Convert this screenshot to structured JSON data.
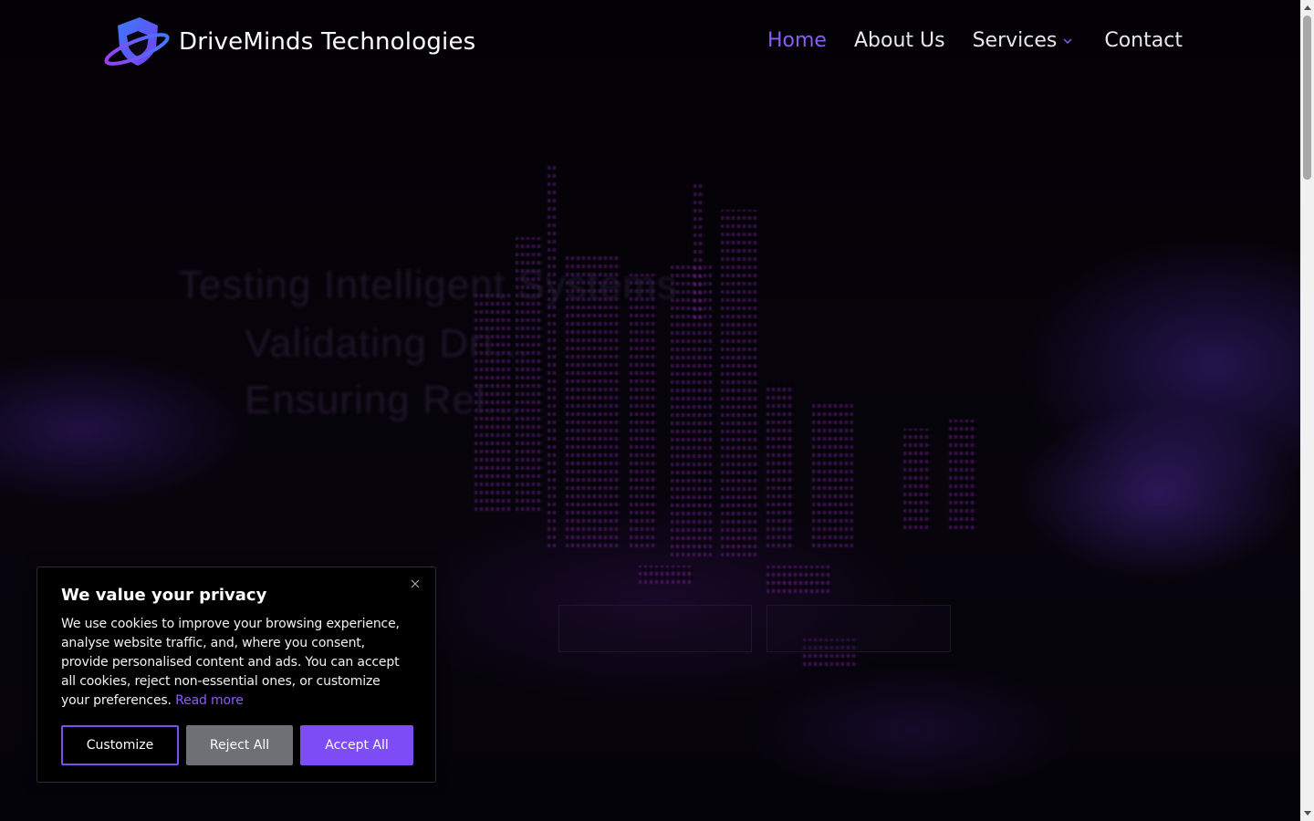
{
  "brand": {
    "name": "DriveMinds Technologies",
    "accent_color": "#8a5cf6"
  },
  "nav": {
    "items": [
      {
        "label": "Home",
        "active": true
      },
      {
        "label": "About Us",
        "active": false
      },
      {
        "label": "Services",
        "active": false,
        "has_dropdown": true
      },
      {
        "label": "Contact",
        "active": false
      }
    ]
  },
  "hero": {
    "lines": [
      "Testing Intelligent Systems",
      "Validating Dri...",
      "Ensuring Rel..."
    ]
  },
  "cookie": {
    "title": "We value your privacy",
    "body": "We use cookies to improve your browsing experience, analyse website traffic, and, where you consent, provide personalised content and ads. You can accept all cookies, reject non-essential ones, or customize your preferences.",
    "read_more": "Read more",
    "buttons": {
      "customize": "Customize",
      "reject": "Reject All",
      "accept": "Accept All"
    },
    "close_icon": "close-icon"
  }
}
